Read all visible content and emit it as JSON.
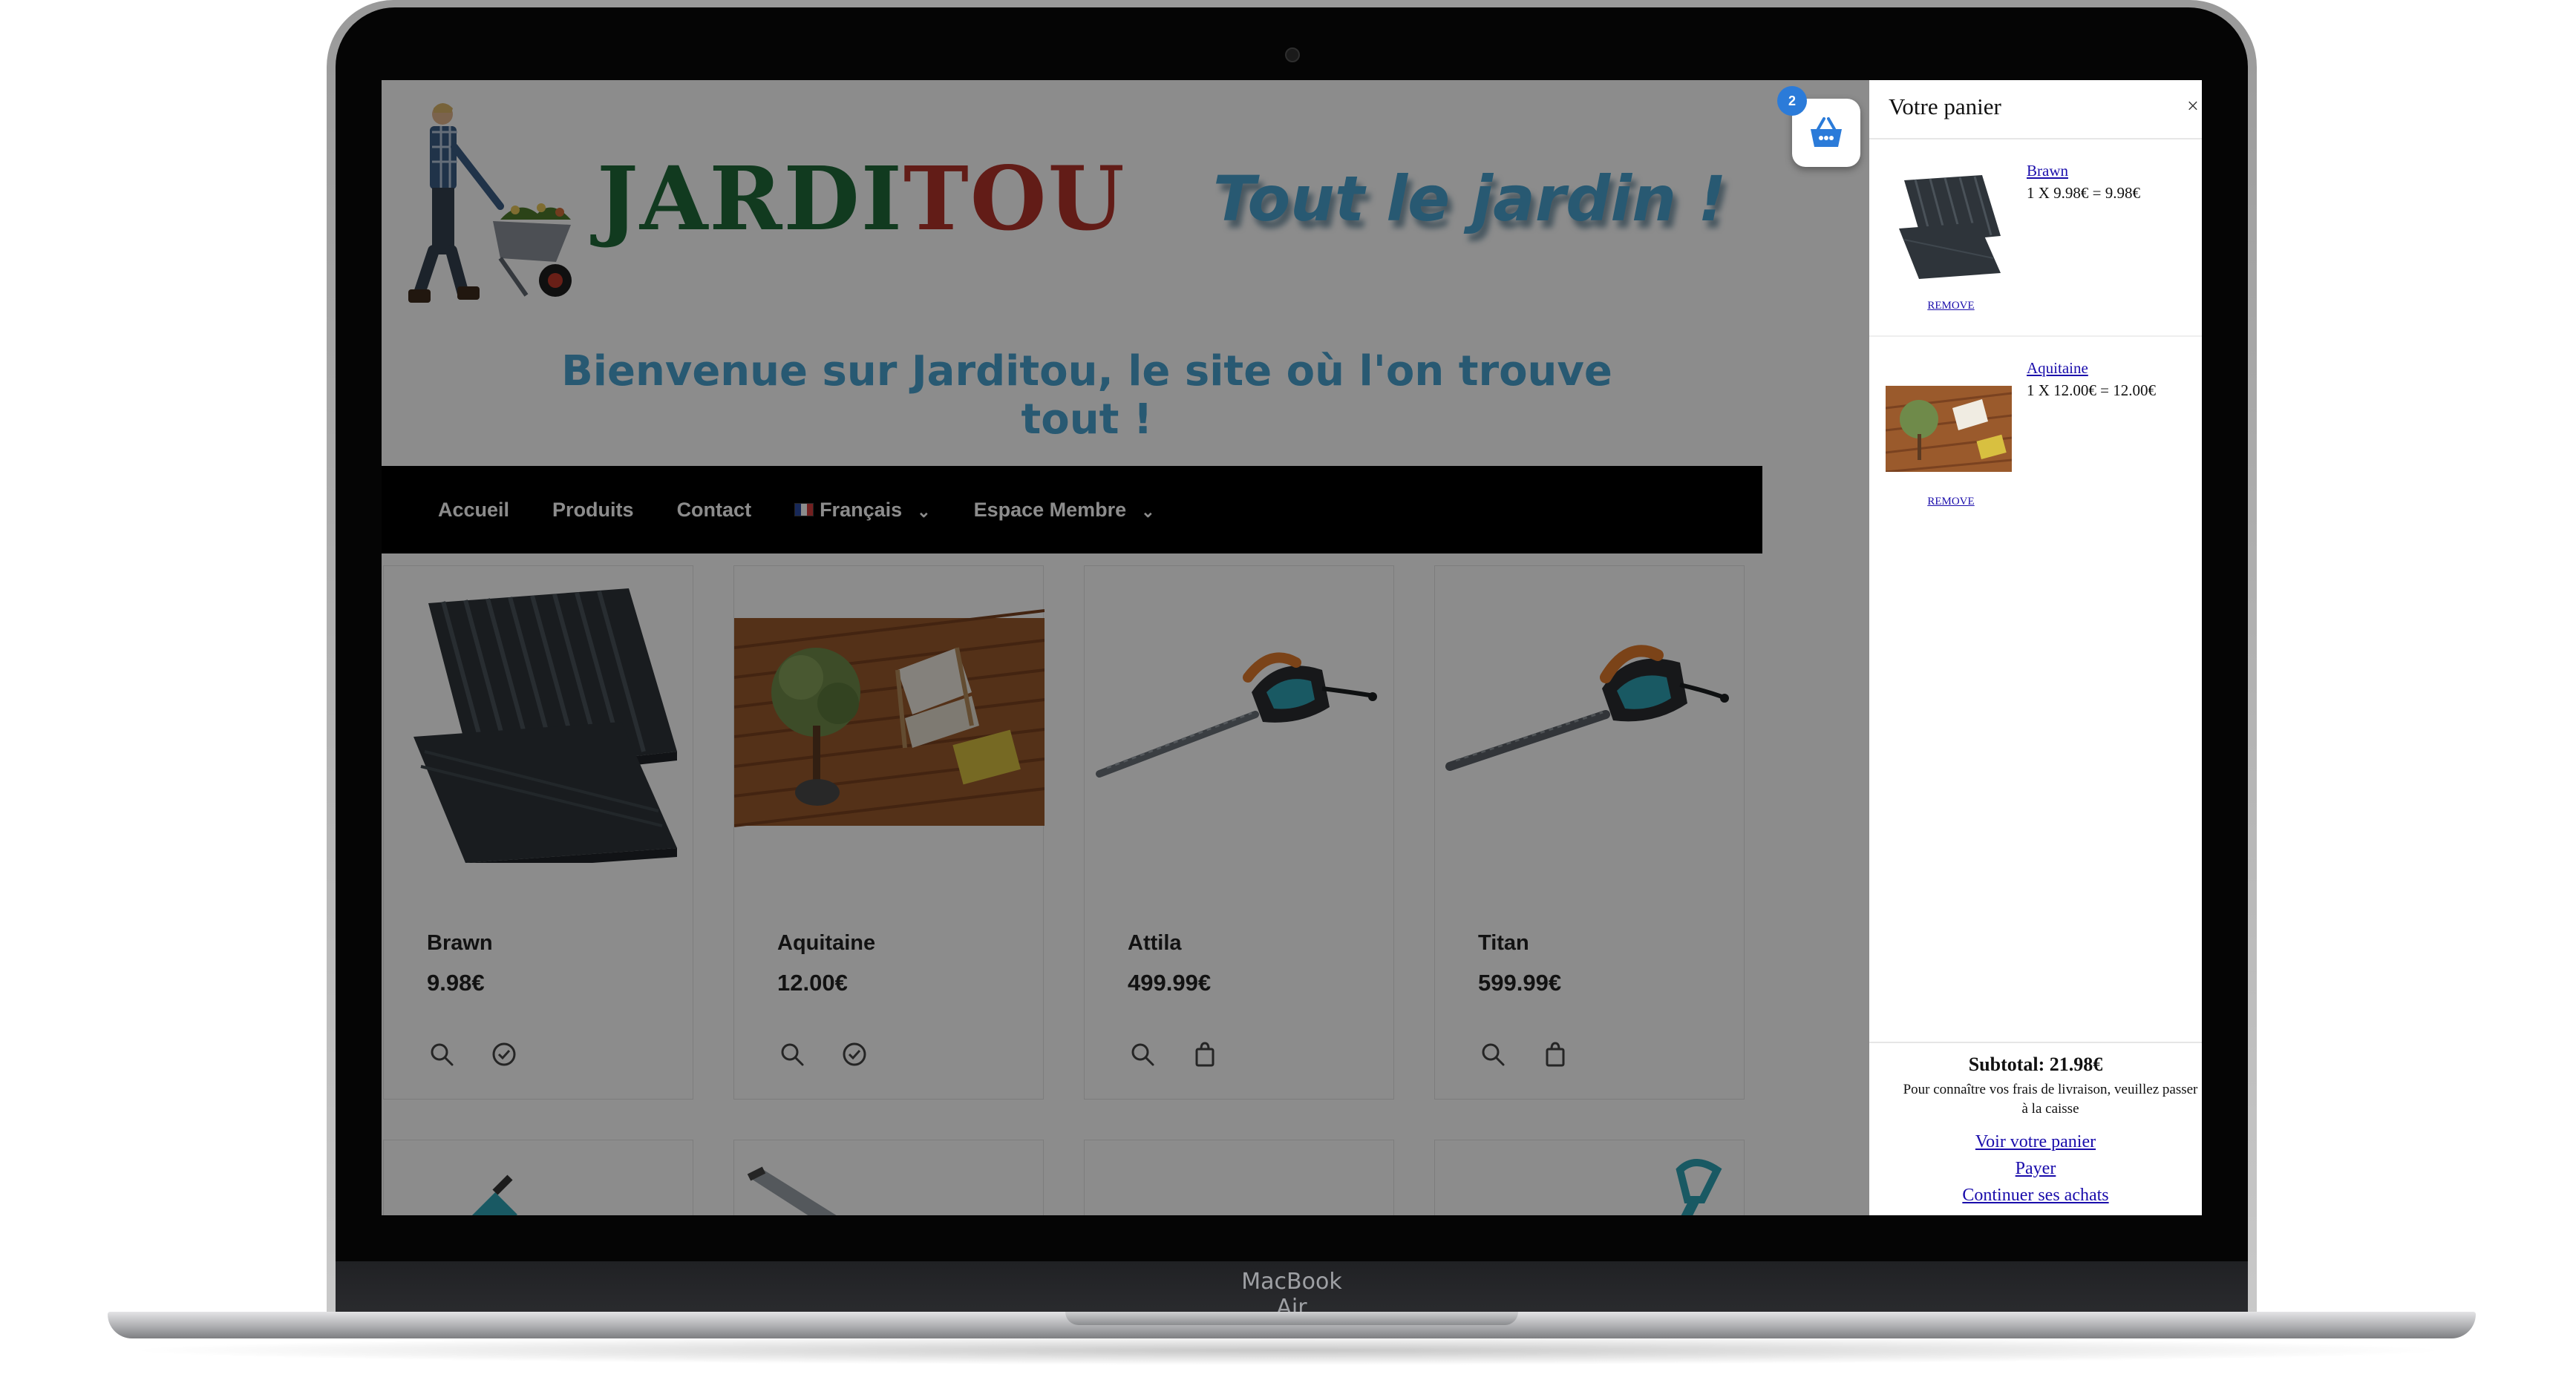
{
  "device": {
    "label": "MacBook Air"
  },
  "header": {
    "brand_part1": "JARDI",
    "brand_part2": "TOU",
    "tagline": "Tout le jardin !",
    "welcome": "Bienvenue sur Jarditou, le site où l'on trouve tout !"
  },
  "nav": {
    "items": [
      {
        "label": "Accueil"
      },
      {
        "label": "Produits"
      },
      {
        "label": "Contact"
      },
      {
        "label": "Français"
      },
      {
        "label": "Espace Membre"
      }
    ]
  },
  "products": [
    {
      "name": "Brawn",
      "price": "9.98€",
      "icons": [
        "search-icon",
        "check-circle-icon"
      ]
    },
    {
      "name": "Aquitaine",
      "price": "12.00€",
      "icons": [
        "search-icon",
        "check-circle-icon"
      ]
    },
    {
      "name": "Attila",
      "price": "499.99€",
      "icons": [
        "search-icon",
        "shopping-bag-icon"
      ]
    },
    {
      "name": "Titan",
      "price": "599.99€",
      "icons": [
        "search-icon",
        "shopping-bag-icon"
      ]
    }
  ],
  "cart_bubble": {
    "count": "2",
    "icon": "basket-icon"
  },
  "cart": {
    "title": "Votre panier",
    "close": "×",
    "items": [
      {
        "name": "Brawn",
        "detail": "1 X 9.98€ = 9.98€",
        "remove": "REMOVE"
      },
      {
        "name": "Aquitaine",
        "detail": "1 X 12.00€ = 12.00€",
        "remove": "REMOVE"
      }
    ],
    "subtotal": "Subtotal: 21.98€",
    "shipping_note": "Pour connaître vos frais de livraison, veuillez passer à la caisse",
    "links": {
      "view": "Voir votre panier",
      "pay": "Payer",
      "continue": "Continuer ses achats"
    }
  },
  "colors": {
    "brand_green": "#1f6a3a",
    "brand_red": "#b3342a",
    "tagline_blue": "#4aa3cf",
    "nav_bg": "#000000",
    "badge_blue": "#2b7bd9",
    "link_blue": "#1a0dab"
  }
}
